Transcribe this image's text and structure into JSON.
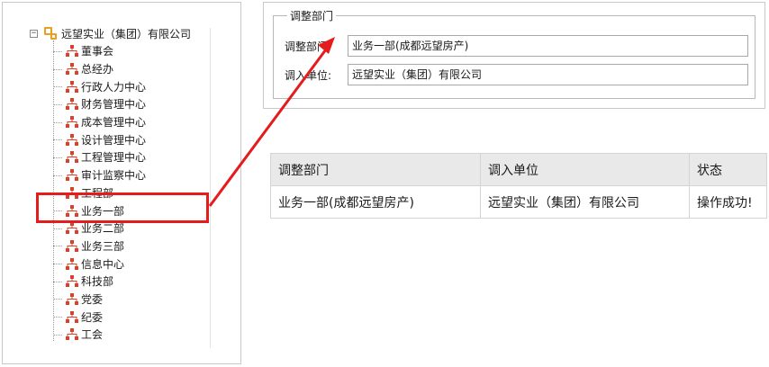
{
  "tree": {
    "root_label": "远望实业（集团）有限公司",
    "toggle_symbol": "−",
    "items": [
      {
        "label": "董事会"
      },
      {
        "label": "总经办"
      },
      {
        "label": "行政人力中心"
      },
      {
        "label": "财务管理中心"
      },
      {
        "label": "成本管理中心"
      },
      {
        "label": "设计管理中心"
      },
      {
        "label": "工程管理中心"
      },
      {
        "label": "审计监察中心"
      },
      {
        "label": "工程部"
      },
      {
        "label": "业务一部"
      },
      {
        "label": "业务二部"
      },
      {
        "label": "业务三部"
      },
      {
        "label": "信息中心"
      },
      {
        "label": "科技部"
      },
      {
        "label": "党委"
      },
      {
        "label": "纪委"
      },
      {
        "label": "工会"
      }
    ],
    "selected_item": "业务一部"
  },
  "form": {
    "legend": "调整部门",
    "department_label": "调整部门",
    "department_value": "业务一部(成都远望房产)",
    "unit_label": "调入单位:",
    "unit_value": "远望实业（集团）有限公司"
  },
  "result_table": {
    "columns": [
      "调整部门",
      "调入单位",
      "状态"
    ],
    "rows": [
      [
        "业务一部(成都远望房产)",
        "远望实业（集团）有限公司",
        "操作成功!"
      ]
    ]
  },
  "colors": {
    "highlight": "#e41c1c",
    "org_icon": "#e8a020",
    "dept_icon": "#d9412b",
    "header_bg": "#e9e9e9"
  }
}
